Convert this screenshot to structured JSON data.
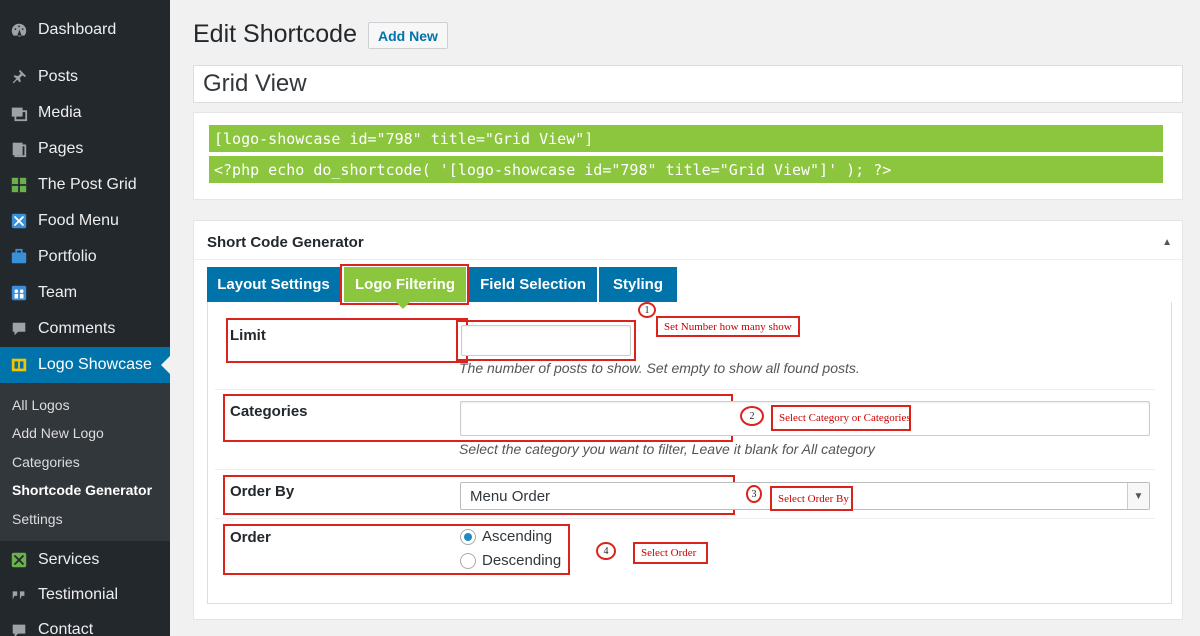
{
  "sidebar": {
    "items": [
      {
        "label": "Dashboard",
        "icon": "dashboard-icon"
      },
      {
        "label": "Posts",
        "icon": "pin-icon"
      },
      {
        "label": "Media",
        "icon": "media-icon"
      },
      {
        "label": "Pages",
        "icon": "pages-icon"
      },
      {
        "label": "The Post Grid",
        "icon": "grid-icon"
      },
      {
        "label": "Food Menu",
        "icon": "food-menu-icon"
      },
      {
        "label": "Portfolio",
        "icon": "portfolio-icon"
      },
      {
        "label": "Team",
        "icon": "team-icon"
      },
      {
        "label": "Comments",
        "icon": "comments-icon"
      },
      {
        "label": "Logo Showcase",
        "icon": "logo-showcase-icon"
      },
      {
        "label": "Services",
        "icon": "services-icon"
      },
      {
        "label": "Testimonial",
        "icon": "quote-icon"
      },
      {
        "label": "Contact",
        "icon": "contact-icon"
      }
    ],
    "submenu": [
      "All Logos",
      "Add New Logo",
      "Categories",
      "Shortcode Generator",
      "Settings"
    ]
  },
  "header": {
    "title": "Edit Shortcode",
    "add_new": "Add New"
  },
  "post_title": "Grid View",
  "shortcodes": {
    "line1": "[logo-showcase id=\"798\" title=\"Grid View\"]",
    "line2": "<?php echo do_shortcode( '[logo-showcase id=\"798\" title=\"Grid View\"]' ); ?>"
  },
  "generator": {
    "title": "Short Code Generator",
    "tabs": [
      "Layout Settings",
      "Logo Filtering",
      "Field Selection",
      "Styling"
    ],
    "fields": {
      "limit": {
        "label": "Limit",
        "value": "",
        "description": "The number of posts to show. Set empty to show all found posts."
      },
      "categories": {
        "label": "Categories",
        "description": "Select the category you want to filter, Leave it blank for All category"
      },
      "order_by": {
        "label": "Order By",
        "selected": "Menu Order"
      },
      "order": {
        "label": "Order",
        "options": [
          "Ascending",
          "Descending"
        ],
        "selected": "Ascending"
      }
    }
  },
  "annotations": [
    {
      "number": "1",
      "text": "Set Number how many show"
    },
    {
      "number": "2",
      "text": "Select Category or Categories"
    },
    {
      "number": "3",
      "text": "Select Order By"
    },
    {
      "number": "4",
      "text": "Select Order"
    }
  ],
  "colors": {
    "sidebar_bg": "#23282d",
    "accent_blue": "#0073aa",
    "accent_green": "#8cc63f",
    "annotation_red": "#d9231c"
  }
}
